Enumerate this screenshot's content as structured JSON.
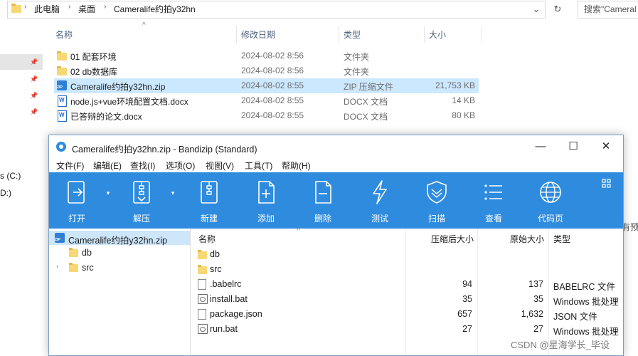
{
  "explorer": {
    "breadcrumb": [
      "此电脑",
      "桌面",
      "Cameralife约拍y32hn"
    ],
    "search_placeholder": "搜索\"Cameral",
    "columns": {
      "name": "名称",
      "date": "修改日期",
      "type": "类型",
      "size": "大小"
    },
    "files": [
      {
        "name": "01  配套环境",
        "date": "2024-08-02 8:56",
        "type": "文件夹",
        "size": "",
        "icon": "folder-icon"
      },
      {
        "name": "02 db数据库",
        "date": "2024-08-02 8:56",
        "type": "文件夹",
        "size": "",
        "icon": "folder-icon"
      },
      {
        "name": "Cameralife约拍y32hn.zip",
        "date": "2024-08-02 8:55",
        "type": "ZIP 压缩文件",
        "size": "21,753 KB",
        "icon": "zip-icon"
      },
      {
        "name": "node.js+vue环境配置文档.docx",
        "date": "2024-08-02 8:55",
        "type": "DOCX 文档",
        "size": "14 KB",
        "icon": "word-icon"
      },
      {
        "name": "已答辩的论文.docx",
        "date": "2024-08-02 8:55",
        "type": "DOCX 文档",
        "size": "80 KB",
        "icon": "word-icon"
      }
    ],
    "nav": {
      "drive_c": "s (C:)",
      "drive_d": "D:)"
    },
    "side_hint": "有预览"
  },
  "bandizip": {
    "title": "Cameralife约拍y32hn.zip - Bandizip (Standard)",
    "window_controls": {
      "minimize": "—",
      "maximize": "☐",
      "close": "✕"
    },
    "menu": [
      "文件(F)",
      "编辑(E)",
      "查找(I)",
      "选项(O)",
      "视图(V)",
      "工具(T)",
      "帮助(H)"
    ],
    "toolbar": [
      {
        "label": "打开",
        "icon": "open-icon"
      },
      {
        "label": "解压",
        "icon": "extract-icon"
      },
      {
        "label": "新建",
        "icon": "new-archive-icon"
      },
      {
        "label": "添加",
        "icon": "add-file-icon"
      },
      {
        "label": "删除",
        "icon": "delete-file-icon"
      },
      {
        "label": "测试",
        "icon": "test-icon"
      },
      {
        "label": "扫描",
        "icon": "scan-shield-icon"
      },
      {
        "label": "查看",
        "icon": "view-list-icon"
      },
      {
        "label": "代码页",
        "icon": "codepage-globe-icon"
      }
    ],
    "tree": {
      "root": "Cameralife约拍y32hn.zip",
      "children": [
        "db",
        "src"
      ]
    },
    "list": {
      "columns": {
        "name": "名称",
        "compressed": "压缩后大小",
        "original": "原始大小",
        "type": "类型"
      },
      "rows": [
        {
          "name": "db",
          "compressed": "",
          "original": "",
          "type": "",
          "icon": "folder-icon"
        },
        {
          "name": "src",
          "compressed": "",
          "original": "",
          "type": "",
          "icon": "folder-icon"
        },
        {
          "name": ".babelrc",
          "compressed": "94",
          "original": "137",
          "type": "BABELRC 文件",
          "icon": "file-icon"
        },
        {
          "name": "install.bat",
          "compressed": "35",
          "original": "35",
          "type": "Windows 批处理",
          "icon": "bat-icon"
        },
        {
          "name": "package.json",
          "compressed": "657",
          "original": "1,632",
          "type": "JSON 文件",
          "icon": "file-icon"
        },
        {
          "name": "run.bat",
          "compressed": "27",
          "original": "27",
          "type": "Windows 批处理",
          "icon": "bat-icon"
        }
      ]
    }
  },
  "watermark": "CSDN @星海学长_毕设"
}
